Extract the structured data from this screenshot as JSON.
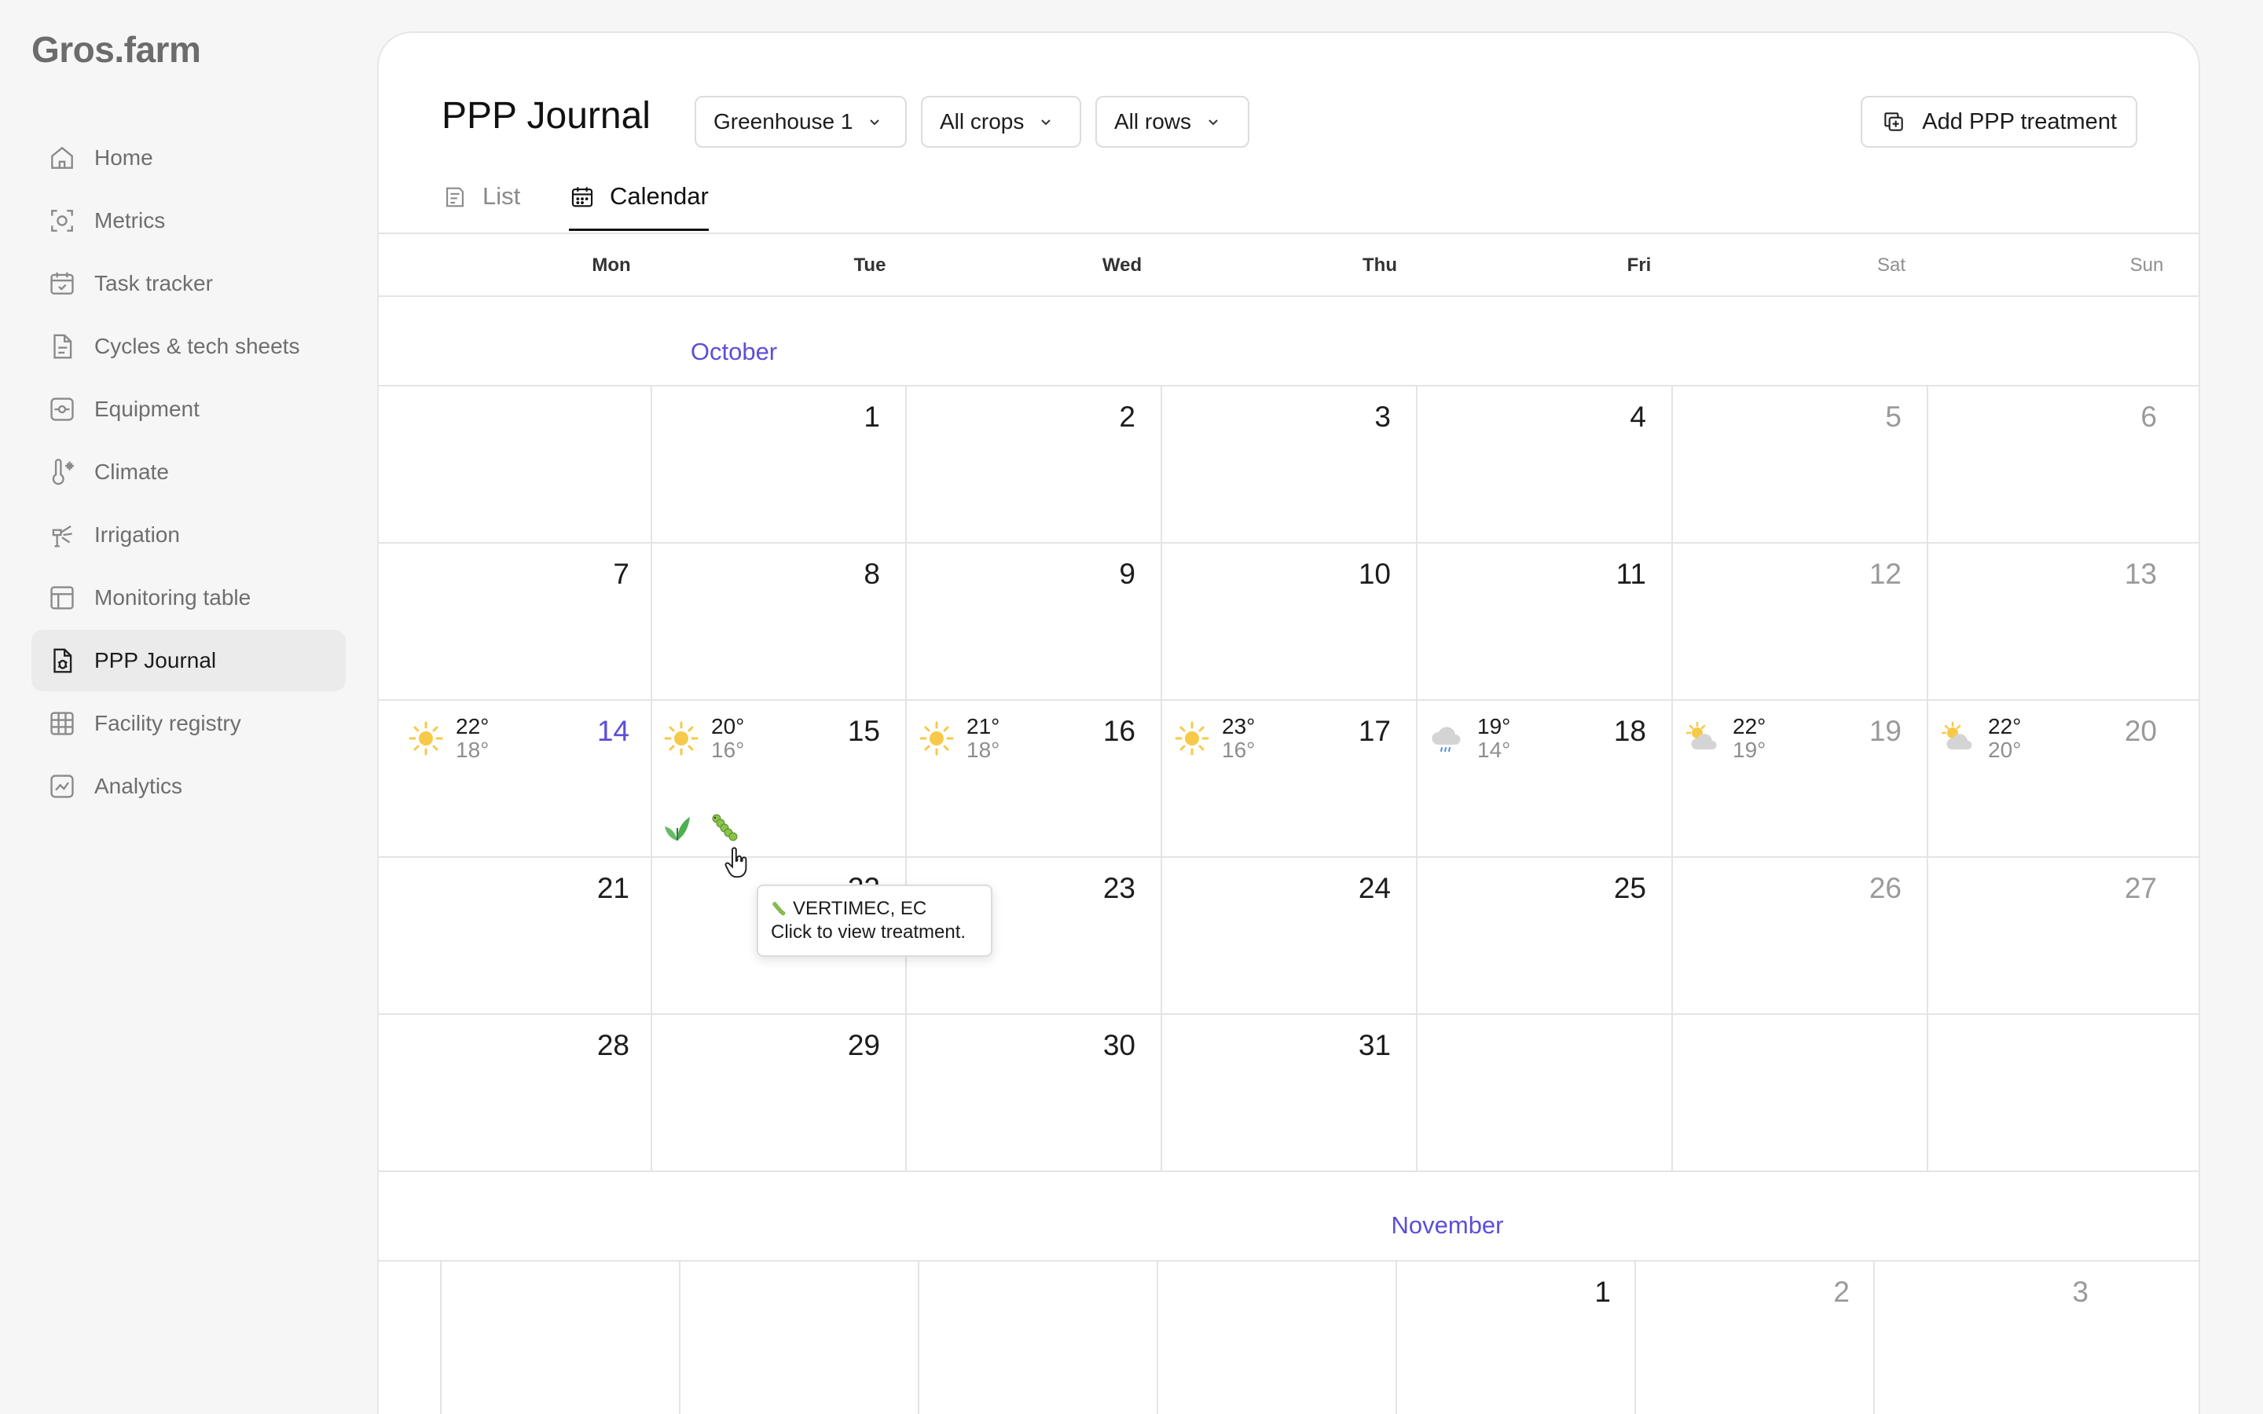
{
  "app": {
    "logo": "Gros.farm"
  },
  "sidebar": {
    "items": [
      {
        "label": "Home",
        "icon": "home-icon",
        "active": false
      },
      {
        "label": "Metrics",
        "icon": "metrics-icon",
        "active": false
      },
      {
        "label": "Task tracker",
        "icon": "task-tracker-icon",
        "active": false
      },
      {
        "label": "Cycles & tech sheets",
        "icon": "document-icon",
        "active": false
      },
      {
        "label": "Equipment",
        "icon": "equipment-icon",
        "active": false
      },
      {
        "label": "Climate",
        "icon": "thermometer-icon",
        "active": false
      },
      {
        "label": "Irrigation",
        "icon": "sprinkler-icon",
        "active": false
      },
      {
        "label": "Monitoring table",
        "icon": "table-icon",
        "active": false
      },
      {
        "label": "PPP Journal",
        "icon": "journal-bug-icon",
        "active": true
      },
      {
        "label": "Facility registry",
        "icon": "grid-icon",
        "active": false
      },
      {
        "label": "Analytics",
        "icon": "analytics-icon",
        "active": false
      }
    ]
  },
  "header": {
    "title": "PPP Journal",
    "filters": {
      "greenhouse": "Greenhouse 1",
      "crops": "All crops",
      "rows": "All rows"
    },
    "add_button": "Add PPP treatment"
  },
  "tabs": {
    "list": "List",
    "calendar": "Calendar",
    "active": "Calendar"
  },
  "calendar": {
    "weekdays": [
      "Mon",
      "Tue",
      "Wed",
      "Thu",
      "Fri",
      "Sat",
      "Sun"
    ],
    "october": {
      "label": "October",
      "weeks": [
        [
          "",
          "1",
          "2",
          "3",
          "4",
          "5",
          "6"
        ],
        [
          "7",
          "8",
          "9",
          "10",
          "11",
          "12",
          "13"
        ],
        [
          "14",
          "15",
          "16",
          "17",
          "18",
          "19",
          "20"
        ],
        [
          "21",
          "22",
          "23",
          "24",
          "25",
          "26",
          "27"
        ],
        [
          "28",
          "29",
          "30",
          "31",
          "",
          "",
          ""
        ]
      ],
      "today": "14",
      "weather": [
        {
          "day": "14",
          "icon": "sun-icon",
          "high": "22°",
          "low": "18°"
        },
        {
          "day": "15",
          "icon": "sun-icon",
          "high": "20°",
          "low": "16°"
        },
        {
          "day": "16",
          "icon": "sun-icon",
          "high": "21°",
          "low": "18°"
        },
        {
          "day": "17",
          "icon": "sun-icon",
          "high": "23°",
          "low": "16°"
        },
        {
          "day": "18",
          "icon": "rain-cloud-icon",
          "high": "19°",
          "low": "14°"
        },
        {
          "day": "19",
          "icon": "partly-cloudy-icon",
          "high": "22°",
          "low": "19°"
        },
        {
          "day": "20",
          "icon": "partly-cloudy-icon",
          "high": "22°",
          "low": "20°"
        }
      ],
      "treatments": [
        {
          "day": "15",
          "icon": "leaf-icon"
        },
        {
          "day": "15",
          "icon": "caterpillar-icon"
        }
      ]
    },
    "november": {
      "label": "November",
      "days": [
        "",
        "",
        "",
        "",
        "1",
        "2",
        "3"
      ]
    }
  },
  "tooltip": {
    "title": "VERTIMEC, EC",
    "subtitle": "Click to view treatment."
  },
  "colors": {
    "accent": "#5b4fd6",
    "sun": "#f7c948",
    "active_nav_bg": "#ebebeb"
  }
}
